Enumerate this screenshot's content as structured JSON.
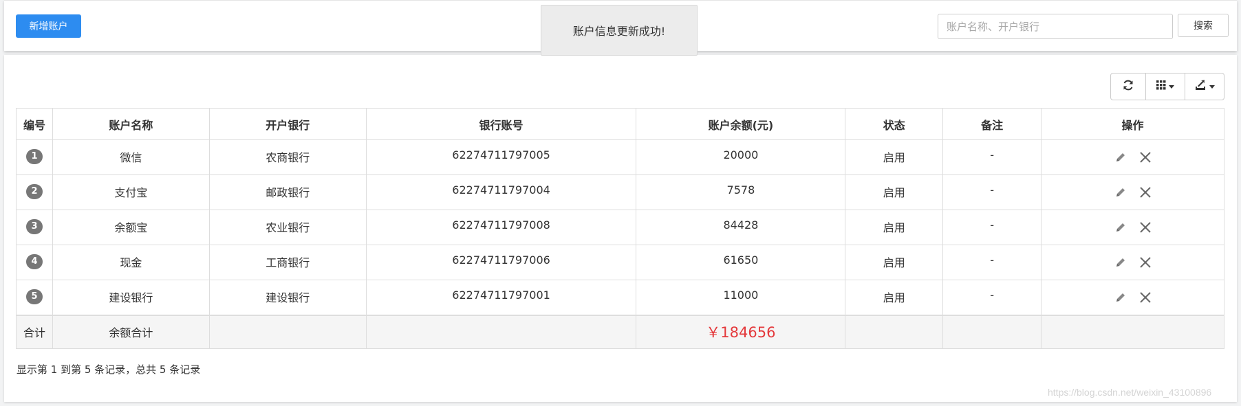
{
  "toolbar": {
    "add_label": "新增账户",
    "search_placeholder": "账户名称、开户银行",
    "search_label": "搜索"
  },
  "toast": {
    "message": "账户信息更新成功!"
  },
  "table_tools": {
    "refresh_icon": "refresh-icon",
    "columns_icon": "grid-icon",
    "export_icon": "export-icon"
  },
  "table": {
    "headers": [
      "编号",
      "账户名称",
      "开户银行",
      "银行账号",
      "账户余额(元)",
      "状态",
      "备注",
      "操作"
    ],
    "rows": [
      {
        "no": "1",
        "name": "微信",
        "bank": "农商银行",
        "account": "62274711797005",
        "balance": "20000",
        "status": "启用",
        "remark": "-"
      },
      {
        "no": "2",
        "name": "支付宝",
        "bank": "邮政银行",
        "account": "62274711797004",
        "balance": "7578",
        "status": "启用",
        "remark": "-"
      },
      {
        "no": "3",
        "name": "余额宝",
        "bank": "农业银行",
        "account": "62274711797008",
        "balance": "84428",
        "status": "启用",
        "remark": "-"
      },
      {
        "no": "4",
        "name": "现金",
        "bank": "工商银行",
        "account": "62274711797006",
        "balance": "61650",
        "status": "启用",
        "remark": "-"
      },
      {
        "no": "5",
        "name": "建设银行",
        "bank": "建设银行",
        "account": "62274711797001",
        "balance": "11000",
        "status": "启用",
        "remark": "-"
      }
    ],
    "footer": {
      "label": "合计",
      "name": "余额合计",
      "total": "￥184656"
    }
  },
  "pagination": {
    "info": "显示第 1 到第 5 条记录，总共 5 条记录"
  },
  "watermark": "https://blog.csdn.net/weixin_43100896",
  "colors": {
    "primary": "#2d8cf0",
    "total": "#e4393c",
    "badge": "#777777"
  }
}
